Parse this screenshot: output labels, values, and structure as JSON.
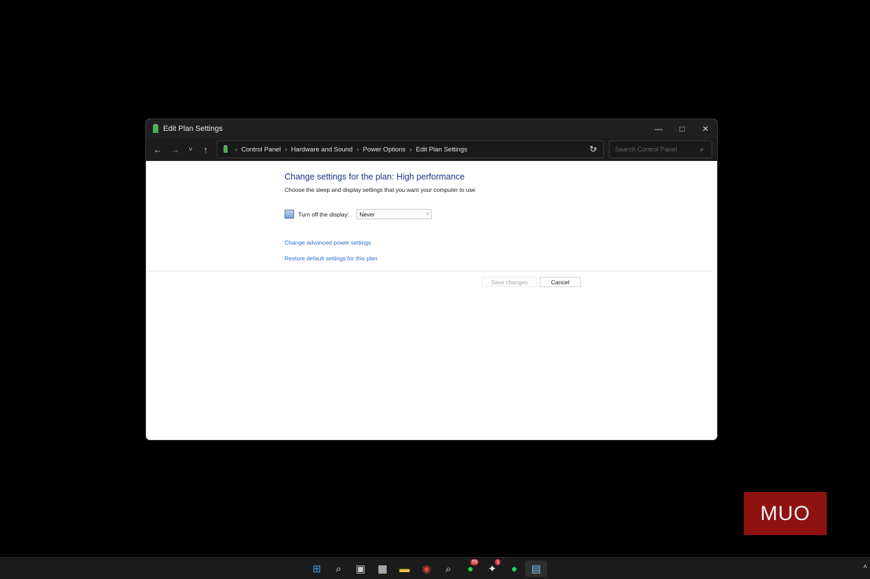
{
  "window": {
    "title": "Edit Plan Settings",
    "controls": {
      "minimize": "—",
      "maximize": "□",
      "close": "✕"
    }
  },
  "nav": {
    "back": "←",
    "forward": "→",
    "recent": "˅",
    "up": "↑",
    "breadcrumbs": [
      "Control Panel",
      "Hardware and Sound",
      "Power Options",
      "Edit Plan Settings"
    ],
    "separator": "›",
    "address_dropdown": "˅",
    "refresh": "↻",
    "search_placeholder": "Search Control Panel",
    "search_icon": "⌕"
  },
  "content": {
    "heading": "Change settings for the plan: High performance",
    "subheading": "Choose the sleep and display settings that you want your computer to use",
    "display_label": "Turn off the display:",
    "display_value": "Never",
    "select_chevron": "˅",
    "link_advanced": "Change advanced power settings",
    "link_restore": "Restore default settings for this plan",
    "save_label": "Save changes",
    "cancel_label": "Cancel"
  },
  "watermark": "MUO",
  "taskbar": {
    "icons": [
      {
        "name": "start-icon",
        "glyph": "⊞",
        "color": "#3aa0f0"
      },
      {
        "name": "search-icon",
        "glyph": "⌕",
        "color": "#e0e0e0"
      },
      {
        "name": "task-view-icon",
        "glyph": "▣",
        "color": "#d0d0d0"
      },
      {
        "name": "store-icon",
        "glyph": "▦",
        "color": "#f0f0f0"
      },
      {
        "name": "file-explorer-icon",
        "glyph": "▬",
        "color": "#f2c13a"
      },
      {
        "name": "chrome-icon",
        "glyph": "◉",
        "color": "#e0463a"
      },
      {
        "name": "magnifier-icon",
        "glyph": "⌕",
        "color": "#e0e0e0"
      },
      {
        "name": "whatsapp-icon",
        "glyph": "●",
        "color": "#2fcf57",
        "badge": "55"
      },
      {
        "name": "slack-icon",
        "glyph": "✦",
        "color": "#e8e8e8",
        "badge": "1"
      },
      {
        "name": "spotify-icon",
        "glyph": "●",
        "color": "#1ed760"
      },
      {
        "name": "control-panel-icon",
        "glyph": "▤",
        "color": "#7cc0f0",
        "active": true
      }
    ],
    "tray_chevron": "˄"
  },
  "colors": {
    "heading": "#1e3287",
    "link": "#2a6ec5",
    "titlebar": "#202020",
    "watermark_bg": "#8e1212"
  }
}
